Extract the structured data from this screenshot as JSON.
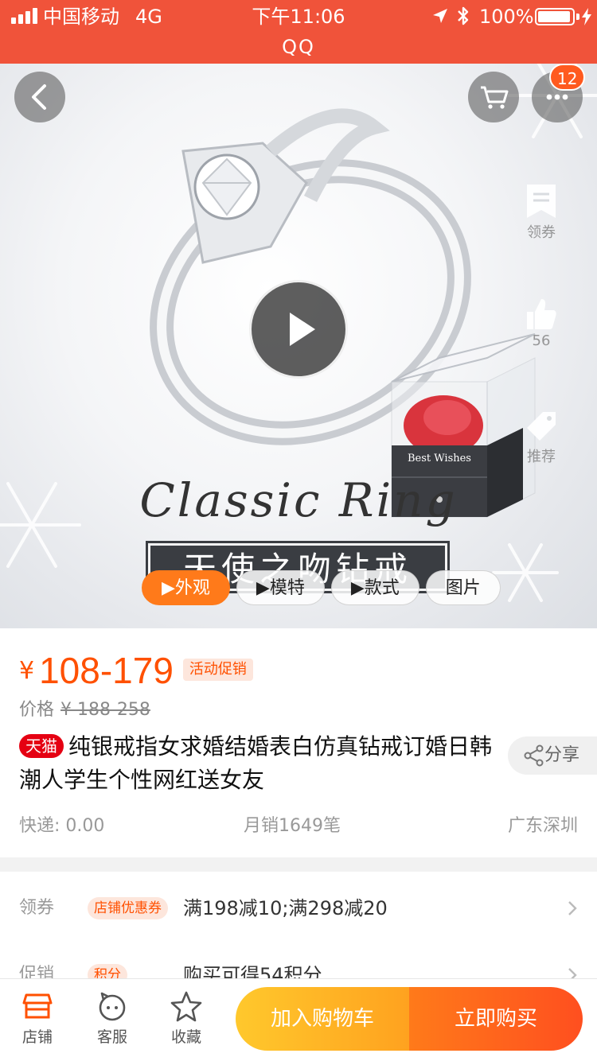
{
  "status_bar": {
    "carrier": "中国移动",
    "network": "4G",
    "time": "下午11:06",
    "battery": "100%"
  },
  "app": {
    "title": "QQ"
  },
  "hero": {
    "cart_badge": "12",
    "side_actions": [
      {
        "label": "领券",
        "icon": "coupon-icon"
      },
      {
        "label": "56",
        "icon": "thumbs-up-icon"
      },
      {
        "label": "推荐",
        "icon": "tag-icon"
      }
    ],
    "art_text": {
      "english": "Classic Ring",
      "chinese": "天使之吻钻戒",
      "box_text": "Best Wishes"
    },
    "tabs": [
      {
        "label": "▶外观",
        "active": true
      },
      {
        "label": "▶模特",
        "active": false
      },
      {
        "label": "▶款式",
        "active": false
      },
      {
        "label": "图片",
        "active": false
      }
    ]
  },
  "product": {
    "currency": "¥",
    "price_range": "108-179",
    "promo_tag": "活动促销",
    "orig_label": "价格",
    "orig_price": "¥ 188-258",
    "store_badge": "天猫",
    "title": "纯银戒指女求婚结婚表白仿真钻戒订婚日韩潮人学生个性网红送女友",
    "share_label": "分享",
    "shipping": "快递: 0.00",
    "monthly_sales": "月销1649笔",
    "location": "广东深圳"
  },
  "coupons": [
    {
      "label": "领券",
      "tag": "店铺优惠券",
      "text": "满198减10;满298减20"
    },
    {
      "label": "促销",
      "tag": "积分",
      "text": "购买可得54积分"
    }
  ],
  "bottom_bar": {
    "items": [
      {
        "label": "店铺",
        "icon": "store-icon"
      },
      {
        "label": "客服",
        "icon": "customer-service-icon"
      },
      {
        "label": "收藏",
        "icon": "star-icon"
      }
    ],
    "add_cart": "加入购物车",
    "buy_now": "立即购买"
  },
  "colors": {
    "accent": "#f0533a",
    "price": "#ff5000",
    "buy": "#ff5a1f",
    "cart": "#ffb323"
  }
}
